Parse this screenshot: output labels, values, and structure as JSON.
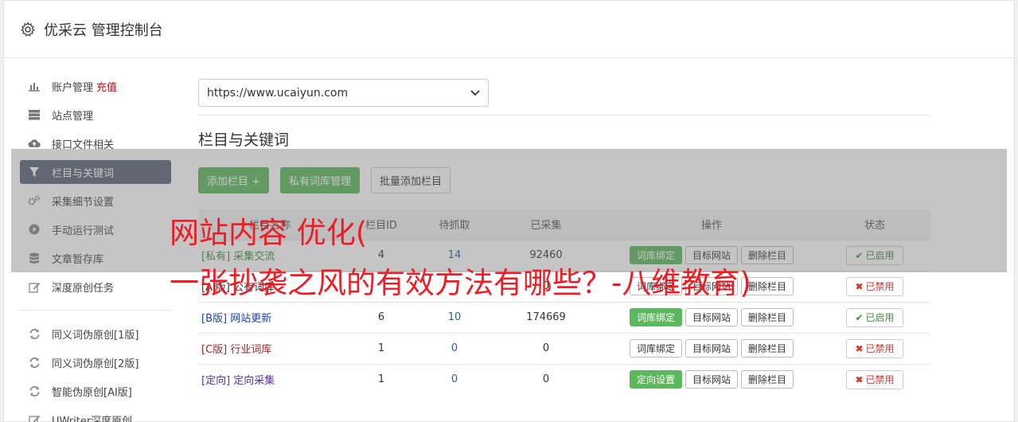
{
  "app": {
    "title": "优采云 管理控制台"
  },
  "sidebar": {
    "items": [
      {
        "label": "账户管理",
        "extra": "充值",
        "icon": "bar-chart-icon"
      },
      {
        "label": "站点管理",
        "icon": "server-icon"
      },
      {
        "label": "接口文件相关",
        "icon": "cloud-upload-icon"
      },
      {
        "label": "栏目与关键词",
        "icon": "filter-icon",
        "active": true
      },
      {
        "label": "采集细节设置",
        "icon": "gears-icon"
      },
      {
        "label": "手动运行测试",
        "icon": "play-circle-icon"
      },
      {
        "label": "文章暂存库",
        "icon": "database-icon"
      },
      {
        "label": "深度原创任务",
        "icon": "edit-icon"
      }
    ],
    "items2": [
      {
        "label": "同义词伪原创[1版]",
        "icon": "refresh-icon"
      },
      {
        "label": "同义词伪原创[2版]",
        "icon": "refresh-icon"
      },
      {
        "label": "智能伪原创[AI版]",
        "icon": "refresh-icon"
      },
      {
        "label": "UWriter深度原创",
        "icon": "edit-icon"
      }
    ]
  },
  "main": {
    "site_select": "https://www.ucaiyun.com",
    "section_title": "栏目与关键词",
    "buttons": {
      "add_column": "添加栏目 +",
      "private_lib": "私有词库管理",
      "batch_add": "批量添加栏目"
    },
    "table": {
      "headers": [
        "栏目名称",
        "栏目ID",
        "待抓取",
        "已采集",
        "操作",
        "状态"
      ],
      "rows": [
        {
          "name": "[私有] 采集交流",
          "id": "4",
          "pending": "14",
          "collected": "92460",
          "op1": "词库绑定",
          "op2": "目标网站",
          "op3": "删除栏目",
          "status": "已启用",
          "on": true,
          "cls": "c-private",
          "op1green": true
        },
        {
          "name": "[AI版] 公有词库",
          "id": "",
          "pending": "",
          "collected": "0",
          "op1": "词库绑定",
          "op2": "目标网站",
          "op3": "删除栏目",
          "status": "已禁用",
          "on": false,
          "cls": "c-ai",
          "op1green": false
        },
        {
          "name": "[B版] 网站更新",
          "id": "6",
          "pending": "10",
          "collected": "174669",
          "op1": "词库绑定",
          "op2": "目标网站",
          "op3": "删除栏目",
          "status": "已启用",
          "on": true,
          "cls": "c-b",
          "op1green": true
        },
        {
          "name": "[C版] 行业词库",
          "id": "1",
          "pending": "0",
          "collected": "0",
          "op1": "词库绑定",
          "op2": "目标网站",
          "op3": "删除栏目",
          "status": "已禁用",
          "on": false,
          "cls": "c-c",
          "op1green": false
        },
        {
          "name": "[定向] 定向采集",
          "id": "1",
          "pending": "0",
          "collected": "0",
          "op1": "定向设置",
          "op2": "目标网站",
          "op3": "删除栏目",
          "status": "已禁用",
          "on": false,
          "cls": "c-dir",
          "op1green": true
        }
      ]
    }
  },
  "overlay": {
    "line1": "网站内容 优化(",
    "line2": "一张抄袭之风的有效方法有哪些？-八维教育)"
  },
  "colors": {
    "green": "#5cb85c",
    "active_nav": "#5b6577",
    "overlay_text": "#ee1c24"
  }
}
